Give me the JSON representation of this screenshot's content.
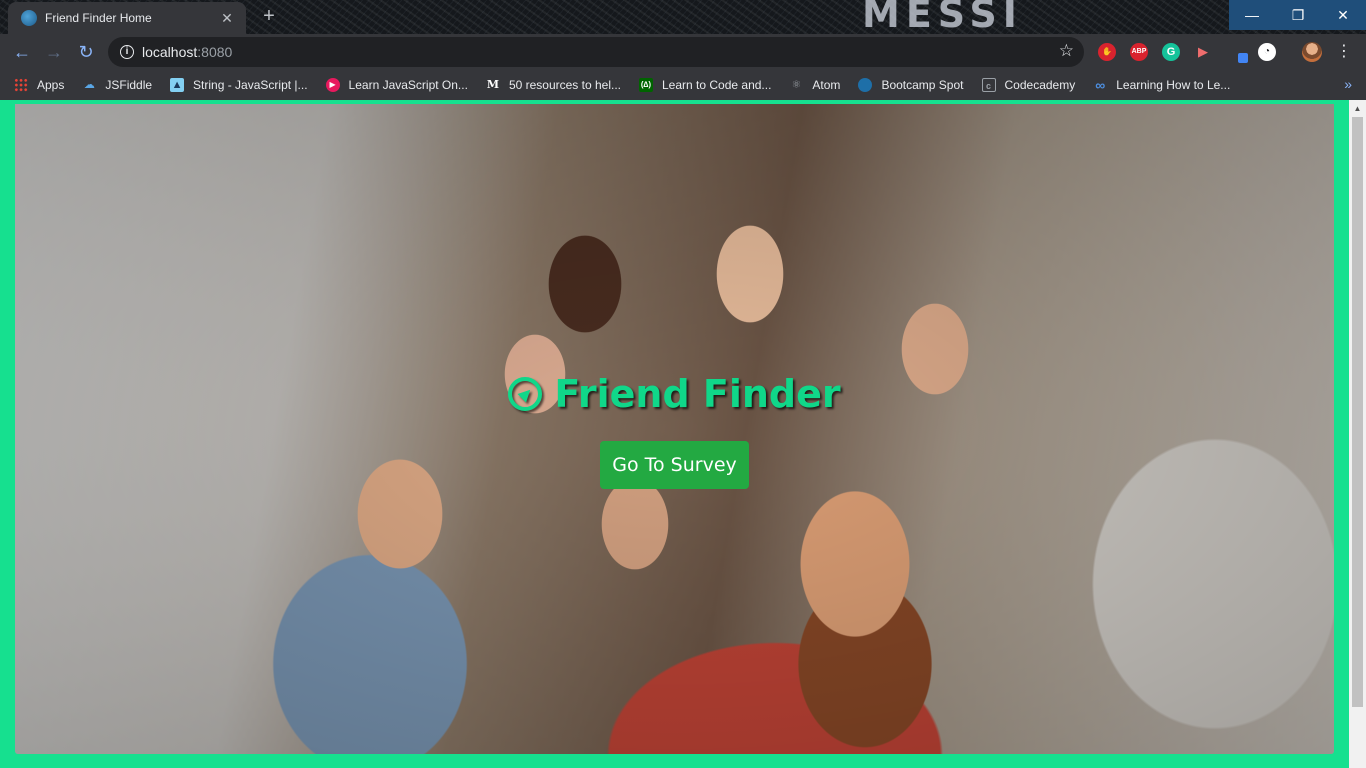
{
  "tab": {
    "title": "Friend Finder Home",
    "close": "✕"
  },
  "new_tab": "+",
  "wallpaper_text": "MESSI",
  "window_controls": {
    "minimize": "—",
    "maximize": "❐",
    "close": "✕"
  },
  "toolbar": {
    "back": "←",
    "forward": "→",
    "reload": "↻",
    "url_host": "localhost",
    "url_port": ":8080",
    "bookmark_star": "☆",
    "menu": "⋮"
  },
  "extensions": [
    {
      "name": "ublock-icon",
      "glyph": "✋"
    },
    {
      "name": "adblock-plus-icon",
      "glyph": "ABP"
    },
    {
      "name": "grammarly-icon",
      "glyph": "G"
    },
    {
      "name": "video-ext-icon",
      "glyph": "▶"
    },
    {
      "name": "pen-ext-icon",
      "glyph": "⁄"
    },
    {
      "name": "mask-ext-icon",
      "glyph": "◔"
    }
  ],
  "bookmarks": [
    {
      "label": "Apps"
    },
    {
      "label": "JSFiddle"
    },
    {
      "label": "String - JavaScript |..."
    },
    {
      "label": "Learn JavaScript On..."
    },
    {
      "label": "50 resources to hel..."
    },
    {
      "label": "Learn to Code and..."
    },
    {
      "label": "Atom"
    },
    {
      "label": "Bootcamp Spot"
    },
    {
      "label": "Codecademy"
    },
    {
      "label": "Learning How to Le..."
    }
  ],
  "bookmarks_overflow": "»",
  "page": {
    "title": "Friend Finder",
    "button_label": "Go To Survey"
  },
  "colors": {
    "brand_green": "#17d58a",
    "button_green": "#28a745",
    "page_border": "#16e08f"
  }
}
